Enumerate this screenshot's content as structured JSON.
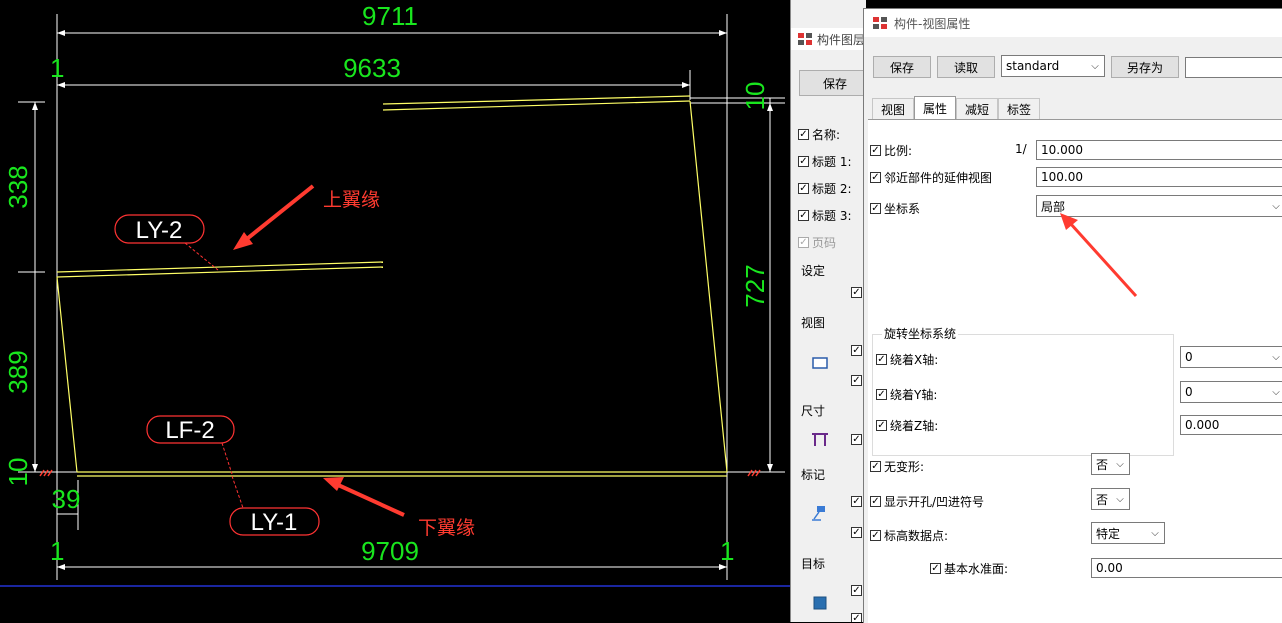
{
  "cad": {
    "dimensions": {
      "top_overall": "9711",
      "top_inner": "9633",
      "left_top": "338",
      "left_mid": "389",
      "left_bottom": "10",
      "right_top": "10",
      "right_main": "727",
      "bottom_small": "39",
      "bottom_overall": "9709",
      "tick_left_top": "1",
      "tick_left_bottom": "1",
      "tick_right_bottom": "1"
    },
    "tags": {
      "ly2": "LY-2",
      "lf2": "LF-2",
      "ly1": "LY-1"
    },
    "annotations": {
      "upper_flange": "上翼缘",
      "lower_flange": "下翼缘"
    },
    "colors": {
      "dim": "#19e61e",
      "line": "#ffff66",
      "arrow": "#ff3b30",
      "tag_border": "#ff3333"
    }
  },
  "back_window": {
    "title": "构件图层",
    "save_label": "保存",
    "rows": [
      {
        "label": "名称:",
        "checked": true
      },
      {
        "label": "标题 1:",
        "checked": true
      },
      {
        "label": "标题 2:",
        "checked": true
      },
      {
        "label": "标题 3:",
        "checked": true
      },
      {
        "label": "页码",
        "checked": true,
        "disabled": true
      }
    ],
    "sections": {
      "settings": "设定",
      "view": "视图",
      "dimension": "尺寸",
      "mark": "标记",
      "target": "目标"
    }
  },
  "dialog": {
    "title": "构件-视图属性",
    "toolbar": {
      "save_label": "保存",
      "read_label": "读取",
      "preset": "standard",
      "saveas_label": "另存为",
      "saveas_name": ""
    },
    "tabs": [
      "视图",
      "属性",
      "减短",
      "标签"
    ],
    "active_tab": "属性",
    "props": {
      "scale_label": "比例:",
      "scale_prefix": "1/",
      "scale_value": "10.000",
      "extension_label": "邻近部件的延伸视图",
      "extension_value": "100.00",
      "coord_label": "坐标系",
      "coord_value": "局部",
      "rotate_group": "旋转坐标系统",
      "rot_x_label": "绕着X轴:",
      "rot_x_value": "0",
      "rot_y_label": "绕着Y轴:",
      "rot_y_value": "0",
      "rot_z_label": "绕着Z轴:",
      "rot_z_value": "0.000",
      "nodeform_label": "无变形:",
      "nodeform_value": "否",
      "holes_label": "显示开孔/凹进符号",
      "holes_value": "否",
      "elev_label": "标高数据点:",
      "elev_value": "特定",
      "base_label": "基本水准面:",
      "base_value": "0.00"
    }
  }
}
